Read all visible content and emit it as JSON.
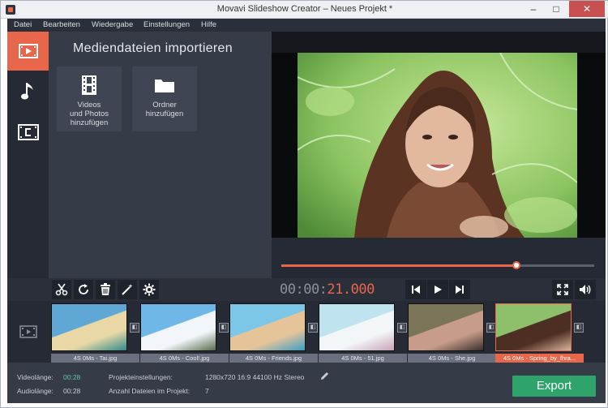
{
  "window": {
    "title": "Movavi Slideshow Creator – Neues Projekt *",
    "min_glyph": "–",
    "max_glyph": "□",
    "close_glyph": "✕"
  },
  "menu": [
    "Datei",
    "Bearbeiten",
    "Wiedergabe",
    "Einstellungen",
    "Hilfe"
  ],
  "sidebar": {
    "tabs": [
      {
        "name": "media-tab",
        "icon": "film-icon",
        "active": true
      },
      {
        "name": "music-tab",
        "icon": "music-note-icon",
        "active": false
      },
      {
        "name": "titles-tab",
        "icon": "titles-icon",
        "active": false
      }
    ]
  },
  "media_panel": {
    "title": "Mediendateien importieren",
    "tiles": [
      {
        "icon": "film-strip-icon",
        "label": "Videos\nund Photos\nhinzufügen"
      },
      {
        "icon": "folder-icon",
        "label": "Ordner\nhinzufügen"
      }
    ]
  },
  "player": {
    "progress": 0.75,
    "time_prefix": "00:00:",
    "time_suffix": "21.000"
  },
  "toolbar": {
    "tools": [
      "scissors-icon",
      "rotate-icon",
      "trash-icon",
      "magic-wand-icon",
      "gear-icon"
    ],
    "controls": [
      "previous-icon",
      "play-icon",
      "next-icon"
    ],
    "right": [
      "fullscreen-icon",
      "volume-icon"
    ]
  },
  "timeline": {
    "clips": [
      {
        "caption": "4S 0Ms - Tai.jpg",
        "colors": [
          "#5fa8d6",
          "#e9d8a6",
          "#2f8a8a"
        ],
        "selected": false
      },
      {
        "caption": "4S 0Ms - Cool!.jpg",
        "colors": [
          "#6fb7e6",
          "#f2f6fb",
          "#5a6b4a"
        ],
        "selected": false
      },
      {
        "caption": "4S 0Ms - Friends.jpg",
        "colors": [
          "#7cc6e8",
          "#e6c49a",
          "#3a9fc2"
        ],
        "selected": false
      },
      {
        "caption": "4S 0Ms - 51.jpg",
        "colors": [
          "#bfe3ef",
          "#f3f6f8",
          "#c7a3b8"
        ],
        "selected": false
      },
      {
        "caption": "4S 0Ms - She.jpg",
        "colors": [
          "#7a7458",
          "#c89c8a",
          "#39302c"
        ],
        "selected": false
      },
      {
        "caption": "4S 0Ms - Spring_by_fhra...",
        "colors": [
          "#8ec06b",
          "#4d2e22",
          "#d9b49a"
        ],
        "selected": true
      }
    ]
  },
  "status": {
    "video_length_label": "Videolänge:",
    "video_length": "00:28",
    "audio_length_label": "Audiolänge:",
    "audio_length": "00:28",
    "project_settings_label": "Projekteinstellungen:",
    "project_settings": "1280x720 16:9 44100 Hz Stereo",
    "file_count_label": "Anzahl Dateien im Projekt:",
    "file_count": "7",
    "export_label": "Export"
  },
  "colors": {
    "accent": "#e8664a",
    "export_green": "#2ea36a",
    "length_teal": "#5cc6a0"
  }
}
